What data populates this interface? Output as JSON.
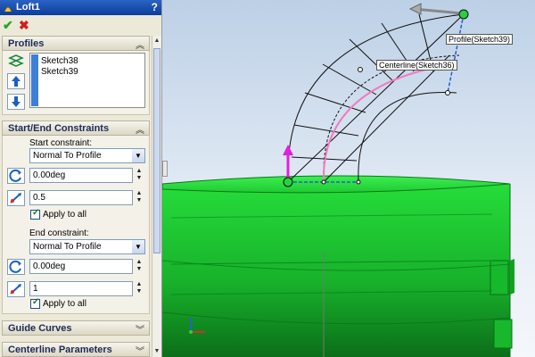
{
  "window": {
    "title": "Loft1",
    "help_label": "?"
  },
  "actions": {
    "ok": "✔",
    "cancel": "✖"
  },
  "profiles": {
    "title": "Profiles",
    "items": [
      "Sketch38",
      "Sketch39"
    ]
  },
  "constraints": {
    "title": "Start/End Constraints",
    "start_label": "Start constraint:",
    "start_value": "Normal To Profile",
    "start_angle": "0.00deg",
    "start_length": "0.5",
    "start_apply_all": "Apply to all",
    "end_label": "End constraint:",
    "end_value": "Normal To Profile",
    "end_angle": "0.00deg",
    "end_length": "1",
    "end_apply_all": "Apply to all"
  },
  "guide_curves": {
    "title": "Guide Curves"
  },
  "centerline": {
    "title": "Centerline Parameters"
  },
  "viewport": {
    "profile_label": "Profile(Sketch39)",
    "centerline_label": "Centerline(Sketch36)"
  },
  "colors": {
    "body_green": "#22d63a",
    "pink_curve": "#f07ac0",
    "handle_magenta": "#e020e0",
    "titlebar_blue": "#0b3e9c"
  }
}
